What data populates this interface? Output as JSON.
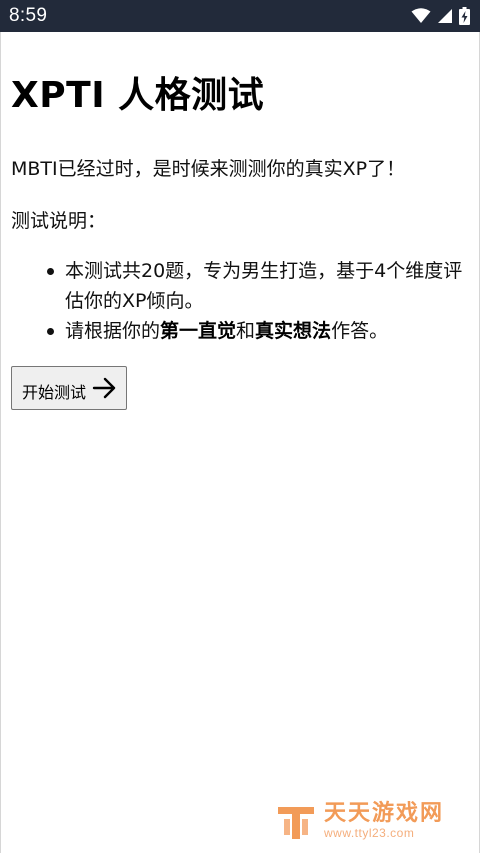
{
  "status_bar": {
    "time": "8:59",
    "icons": [
      "wifi-icon",
      "cellular-signal-icon",
      "battery-charging-icon"
    ]
  },
  "page": {
    "title": "XPTI 人格测试",
    "intro": "MBTI已经过时，是时候来测测你的真实XP了！",
    "section_label": "测试说明：",
    "rules": [
      {
        "parts": [
          {
            "text": "本测试共20题，专为男生打造，基于4个维度评估你的XP倾向。",
            "bold": false
          }
        ]
      },
      {
        "parts": [
          {
            "text": "请根据你的",
            "bold": false
          },
          {
            "text": "第一直觉",
            "bold": true
          },
          {
            "text": "和",
            "bold": false
          },
          {
            "text": "真实想法",
            "bold": true
          },
          {
            "text": "作答。",
            "bold": false
          }
        ]
      }
    ],
    "start_button_label": "开始测试",
    "start_button_icon": "arrow-right-icon"
  },
  "watermark": {
    "name": "天天游戏网",
    "url": "www.ttyl23.com"
  },
  "colors": {
    "status_bar_bg": "#222a3a",
    "watermark_orange": "#f08a3c"
  }
}
